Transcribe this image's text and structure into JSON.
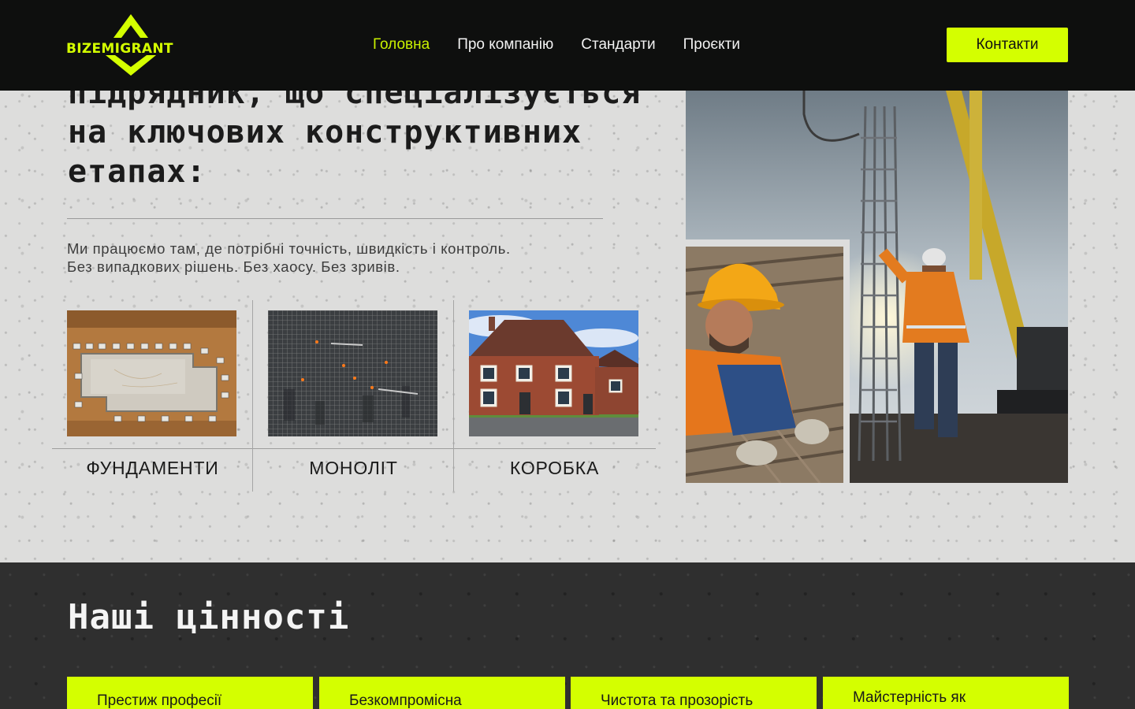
{
  "header": {
    "logo_text": "BIZEMIGRANT",
    "nav": [
      {
        "label": "Головна",
        "active": true
      },
      {
        "label": "Про компанію",
        "active": false
      },
      {
        "label": "Стандарти",
        "active": false
      },
      {
        "label": "Проєкти",
        "active": false
      }
    ],
    "contact_label": "Контакти"
  },
  "hero": {
    "title_lines": [
      "підрядник, що спеціалізується",
      "на ключових конструктивних",
      "етапах:"
    ],
    "description_lines": [
      "Ми працюємо там, де потрібні точність, швидкість і контроль.",
      "Без випадкових рішень. Без хаосу. Без зривів."
    ],
    "stages": [
      {
        "label": "ФУНДАМЕНТИ",
        "image": "foundation-aerial-image"
      },
      {
        "label": "МОНОЛІТ",
        "image": "rebar-grid-image"
      },
      {
        "label": "КОРОБКА",
        "image": "brick-house-image"
      }
    ]
  },
  "values": {
    "title": "Наші цінності",
    "cards": [
      "Престиж професії",
      "Безкомпромісна",
      "Чистота та прозорість",
      "Майстерність як"
    ]
  },
  "colors": {
    "accent": "#d4ff00",
    "header_bg": "#0e0f0e",
    "dark_section_bg": "#2f2f2f",
    "light_bg": "#dddddc"
  }
}
